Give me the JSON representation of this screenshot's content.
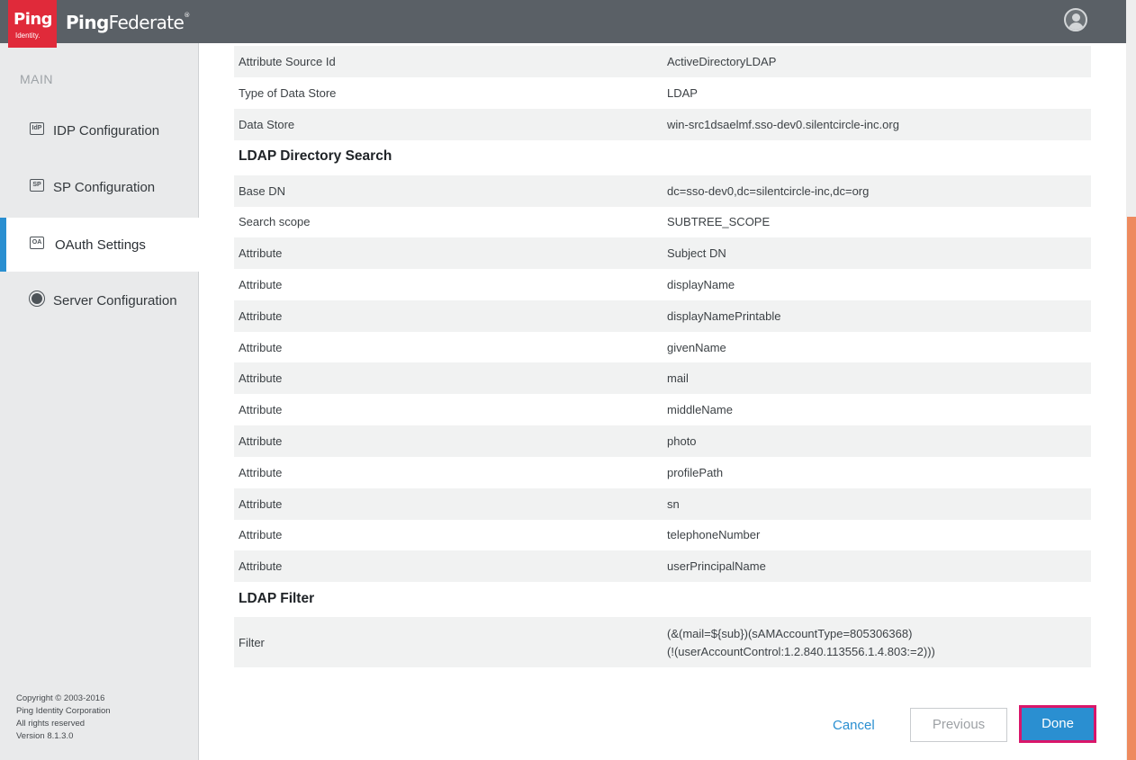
{
  "header": {
    "logo_text": "Ping",
    "logo_sub": "Identity.",
    "brand_bold": "Ping",
    "brand_rest": "Federate",
    "brand_mark": "®"
  },
  "sidebar": {
    "section_label": "MAIN",
    "items": [
      {
        "label": "IDP Configuration",
        "icon": "IdP"
      },
      {
        "label": "SP Configuration",
        "icon": "SP"
      },
      {
        "label": "OAuth Settings",
        "icon": "OA"
      },
      {
        "label": "Server Configuration",
        "icon": "server"
      }
    ],
    "copyright": {
      "line1": "Copyright © 2003-2016",
      "line2": "Ping Identity Corporation",
      "line3": "All rights reserved",
      "line4": "Version 8.1.3.0"
    }
  },
  "summary": {
    "top_rows": [
      {
        "key": "Attribute Source Id",
        "value": "ActiveDirectoryLDAP"
      },
      {
        "key": "Type of Data Store",
        "value": "LDAP"
      },
      {
        "key": "Data Store",
        "value": "win-src1dsaelmf.sso-dev0.silentcircle-inc.org"
      }
    ],
    "ldap_search_title": "LDAP Directory Search",
    "ldap_search_rows": [
      {
        "key": "Base DN",
        "value": "dc=sso-dev0,dc=silentcircle-inc,dc=org"
      },
      {
        "key": "Search scope",
        "value": "SUBTREE_SCOPE"
      },
      {
        "key": "Attribute",
        "value": "Subject DN"
      },
      {
        "key": "Attribute",
        "value": "displayName"
      },
      {
        "key": "Attribute",
        "value": "displayNamePrintable"
      },
      {
        "key": "Attribute",
        "value": "givenName"
      },
      {
        "key": "Attribute",
        "value": "mail"
      },
      {
        "key": "Attribute",
        "value": "middleName"
      },
      {
        "key": "Attribute",
        "value": "photo"
      },
      {
        "key": "Attribute",
        "value": "profilePath"
      },
      {
        "key": "Attribute",
        "value": "sn"
      },
      {
        "key": "Attribute",
        "value": "telephoneNumber"
      },
      {
        "key": "Attribute",
        "value": "userPrincipalName"
      }
    ],
    "ldap_filter_title": "LDAP Filter",
    "filter": {
      "key": "Filter",
      "value_line1": "(&(mail=${sub})(sAMAccountType=805306368)",
      "value_line2": "(!(userAccountControl:1.2.840.113556.1.4.803:=2)))"
    }
  },
  "buttons": {
    "cancel": "Cancel",
    "previous": "Previous",
    "done": "Done"
  },
  "colors": {
    "header_bg": "#5a6066",
    "logo_red": "#e02a3a",
    "accent_blue": "#2a8fd1",
    "done_border": "#d9166a",
    "scroll_thumb": "#ee8a5e"
  }
}
